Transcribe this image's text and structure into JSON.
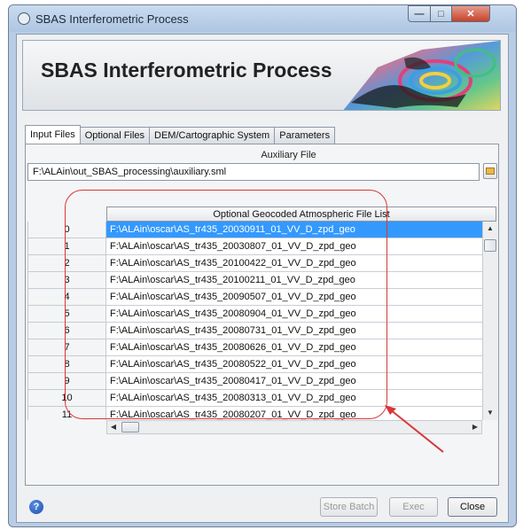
{
  "window": {
    "title": "SBAS Interferometric Process"
  },
  "banner": {
    "title": "SBAS Interferometric Process"
  },
  "tabs": [
    {
      "label": "Input Files",
      "active": true
    },
    {
      "label": "Optional Files",
      "active": false
    },
    {
      "label": "DEM/Cartographic System",
      "active": false
    },
    {
      "label": "Parameters",
      "active": false
    }
  ],
  "auxiliary": {
    "label": "Auxiliary File",
    "value": "F:\\ALAin\\out_SBAS_processing\\auxiliary.sml"
  },
  "file_list": {
    "header": "Optional Geocoded Atmospheric File List",
    "selected_index": 0,
    "rows": [
      {
        "index": "0",
        "value": "F:\\ALAin\\oscar\\AS_tr435_20030911_01_VV_D_zpd_geo"
      },
      {
        "index": "1",
        "value": "F:\\ALAin\\oscar\\AS_tr435_20030807_01_VV_D_zpd_geo"
      },
      {
        "index": "2",
        "value": "F:\\ALAin\\oscar\\AS_tr435_20100422_01_VV_D_zpd_geo"
      },
      {
        "index": "3",
        "value": "F:\\ALAin\\oscar\\AS_tr435_20100211_01_VV_D_zpd_geo"
      },
      {
        "index": "4",
        "value": "F:\\ALAin\\oscar\\AS_tr435_20090507_01_VV_D_zpd_geo"
      },
      {
        "index": "5",
        "value": "F:\\ALAin\\oscar\\AS_tr435_20080904_01_VV_D_zpd_geo"
      },
      {
        "index": "6",
        "value": "F:\\ALAin\\oscar\\AS_tr435_20080731_01_VV_D_zpd_geo"
      },
      {
        "index": "7",
        "value": "F:\\ALAin\\oscar\\AS_tr435_20080626_01_VV_D_zpd_geo"
      },
      {
        "index": "8",
        "value": "F:\\ALAin\\oscar\\AS_tr435_20080522_01_VV_D_zpd_geo"
      },
      {
        "index": "9",
        "value": "F:\\ALAin\\oscar\\AS_tr435_20080417_01_VV_D_zpd_geo"
      },
      {
        "index": "10",
        "value": "F:\\ALAin\\oscar\\AS_tr435_20080313_01_VV_D_zpd_geo"
      },
      {
        "index": "11",
        "value": "F:\\ALAin\\oscar\\AS_tr435_20080207_01_VV_D_zpd_geo"
      }
    ]
  },
  "footer": {
    "help_icon": "help-icon",
    "store_batch_label": "Store Batch",
    "exec_label": "Exec",
    "close_label": "Close"
  },
  "colors": {
    "selection": "#3399ff",
    "annotation": "#d8373a",
    "titlebar": "#b8cde5"
  }
}
